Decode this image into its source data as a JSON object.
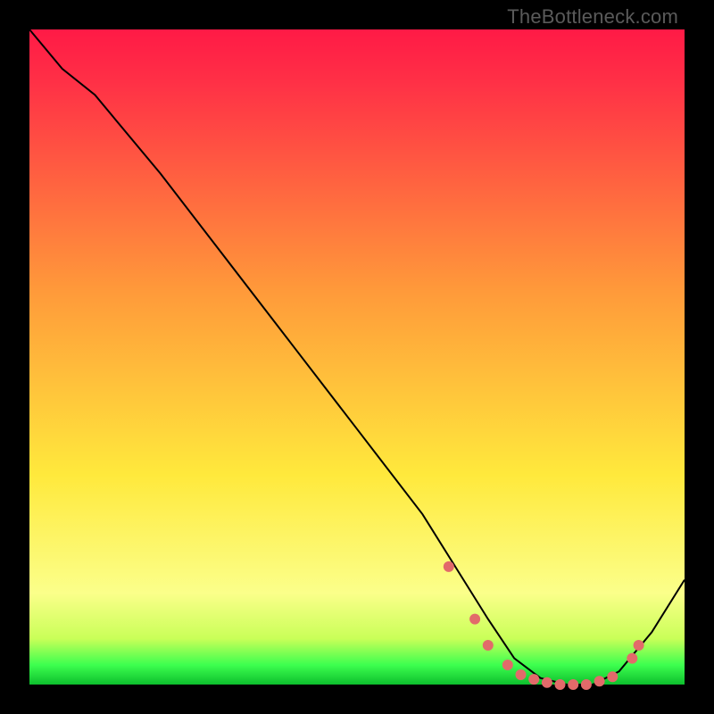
{
  "watermark": "TheBottleneck.com",
  "colors": {
    "top": "#ff1a46",
    "red": "#ff3046",
    "orange": "#ff9a3a",
    "yellow": "#ffe93c",
    "lightyellow": "#fbff8a",
    "yellowgreen": "#c9ff58",
    "green": "#3dff4f",
    "darkgreen": "#0dbf2d",
    "marker": "#e26a6a"
  },
  "chart_data": {
    "type": "line",
    "title": "",
    "xlabel": "",
    "ylabel": "",
    "xlim": [
      0,
      100
    ],
    "ylim": [
      0,
      100
    ],
    "series": [
      {
        "name": "bottleneck-curve",
        "x": [
          0,
          5,
          10,
          20,
          30,
          40,
          50,
          60,
          65,
          70,
          74,
          78,
          82,
          86,
          90,
          95,
          100
        ],
        "y": [
          100,
          94,
          90,
          78,
          65,
          52,
          39,
          26,
          18,
          10,
          4,
          1,
          0,
          0,
          2,
          8,
          16
        ]
      }
    ],
    "markers": {
      "name": "highlight-points",
      "x": [
        64,
        68,
        70,
        73,
        75,
        77,
        79,
        81,
        83,
        85,
        87,
        89,
        92,
        93
      ],
      "y": [
        18,
        10,
        6,
        3,
        1.5,
        0.8,
        0.3,
        0,
        0,
        0,
        0.5,
        1.2,
        4,
        6
      ]
    }
  }
}
